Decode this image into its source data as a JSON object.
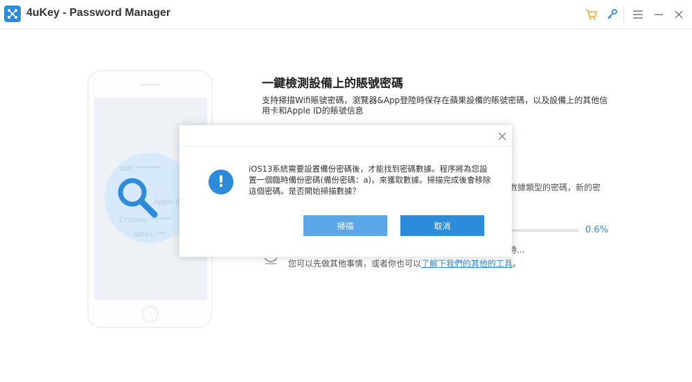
{
  "app": {
    "title": "4uKey - Password Manager"
  },
  "titlebar": {
    "icons": [
      "cart-icon",
      "key-icon",
      "menu-icon",
      "minimize-icon",
      "close-icon"
    ],
    "accent": "#f5a623"
  },
  "illustration": {
    "ghost_labels": [
      "Wifi: ********",
      "Apple ID",
      "Chrome: *******",
      "safari: ***"
    ]
  },
  "main": {
    "heading": "一鍵檢測設備上的賬號密碼",
    "description": "支持掃描Wifi賬號密碼，瀏覽器&App登陸時保存在蘋果設備的賬號密碼，以及設備上的其他信用卡和Apple ID的賬號信息",
    "behind_text_1": "數據類型的密碼，新的密",
    "progress": {
      "percent_label": "0.6%",
      "value": 0.006
    },
    "behind_text_2": "待...",
    "hint_prefix": "您可以先做其他事情，或者你也可以",
    "hint_link": "了解下我們的其他的工具",
    "hint_suffix": "。"
  },
  "modal": {
    "message": "iOS13系統需要設置備份密碼後，才能找到密碼數據。程序將為您設置一個臨時備份密碼(備份密碼：a)，來獲取數據。掃描完成後會移除這個密碼。是否開始掃描數據？",
    "scan_label": "掃描",
    "cancel_label": "取消",
    "accent": "#2d8bdc"
  }
}
